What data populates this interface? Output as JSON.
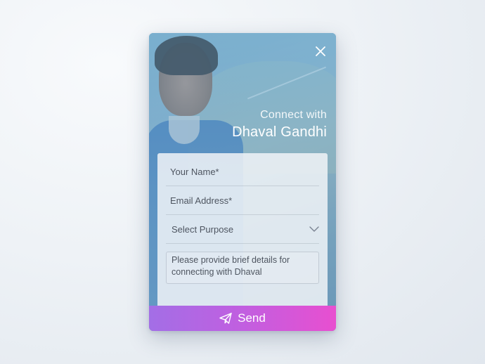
{
  "header": {
    "connect_label": "Connect with",
    "person_name": "Dhaval Gandhi"
  },
  "form": {
    "name_placeholder": "Your Name*",
    "email_placeholder": "Email Address*",
    "purpose_select": "Select Purpose",
    "details_placeholder": "Please provide brief details for connecting with Dhaval"
  },
  "actions": {
    "send_label": "Send",
    "send_icon": "paper-plane-icon",
    "close_icon": "close-icon"
  },
  "colors": {
    "send_gradient_start": "#a36ee6",
    "send_gradient_end": "#e84fd0",
    "text": "#4e5560"
  }
}
